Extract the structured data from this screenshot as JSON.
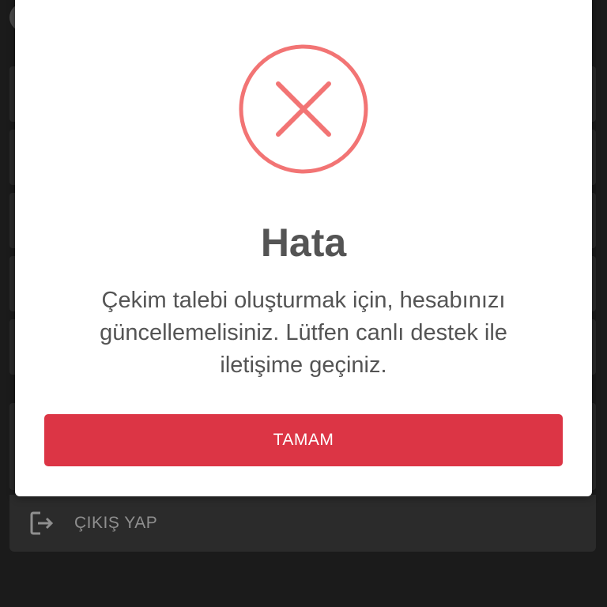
{
  "dialog": {
    "icon": "error-x-icon",
    "title": "Hata",
    "message": "Çekim talebi oluşturmak için, hesabınızı güncellemelisiniz. Lütfen canlı destek ile iletişime geçiniz.",
    "ok_label": "TAMAM"
  },
  "background": {
    "logout": {
      "icon": "logout-icon",
      "label": "ÇIKIŞ YAP"
    }
  },
  "colors": {
    "error_icon": "#f27474",
    "button": "#dc3545",
    "title_text": "#545454",
    "overlay_bg": "#1b1b1b"
  }
}
